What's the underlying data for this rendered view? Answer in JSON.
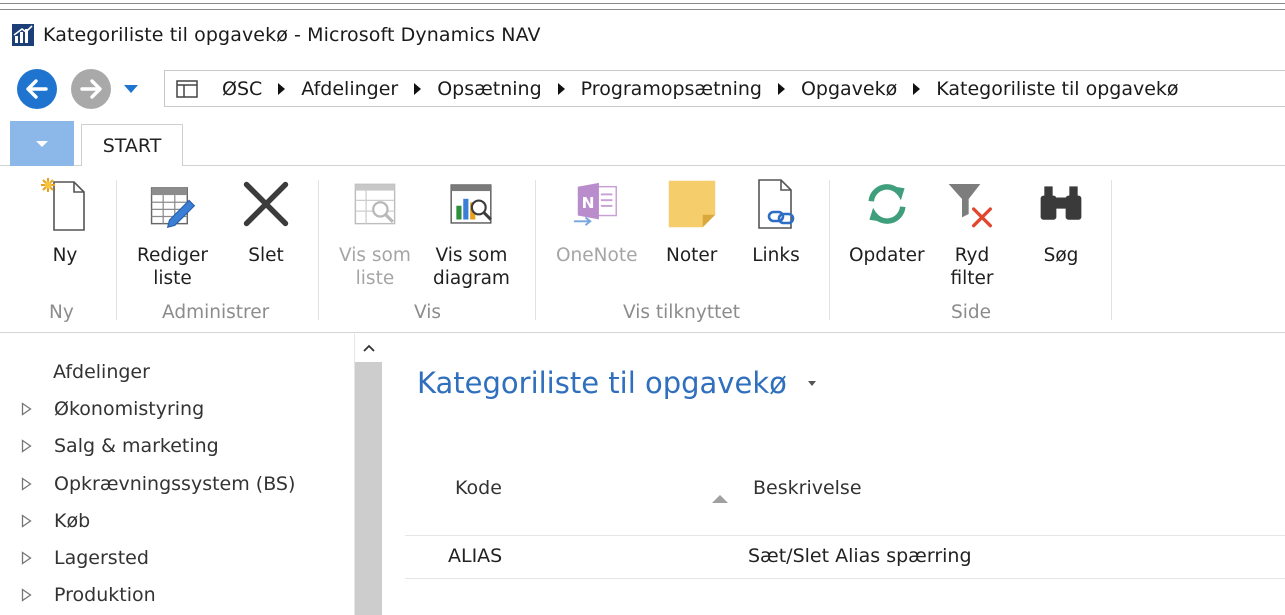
{
  "window": {
    "title": "Kategoriliste til opgavekø - Microsoft Dynamics NAV"
  },
  "breadcrumb": [
    "ØSC",
    "Afdelinger",
    "Opsætning",
    "Programopsætning",
    "Opgavekø",
    "Kategoriliste til opgavekø"
  ],
  "tabs": {
    "start": "START"
  },
  "ribbon": {
    "ny": "Ny",
    "rediger_liste": "Rediger\nliste",
    "slet": "Slet",
    "vis_som_liste": "Vis som\nliste",
    "vis_som_diagram": "Vis som\ndiagram",
    "onenote": "OneNote",
    "noter": "Noter",
    "links": "Links",
    "opdater": "Opdater",
    "ryd_filter": "Ryd\nfilter",
    "sog": "Søg",
    "groups": {
      "ny": "Ny",
      "administrer": "Administrer",
      "vis": "Vis",
      "vis_tilknyttet": "Vis tilknyttet",
      "side": "Side"
    }
  },
  "leftnav": {
    "header": "Afdelinger",
    "items": [
      "Økonomistyring",
      "Salg & marketing",
      "Opkrævningssystem (BS)",
      "Køb",
      "Lagersted",
      "Produktion"
    ]
  },
  "page": {
    "title": "Kategoriliste til opgavekø"
  },
  "table": {
    "columns": [
      "Kode",
      "Beskrivelse"
    ],
    "rows": [
      [
        "ALIAS",
        "Sæt/Slet Alias spærring"
      ]
    ]
  },
  "colors": {
    "accent": "#2f6fbd",
    "back_button": "#1e74cf",
    "file_tab": "#8bb8e8"
  }
}
